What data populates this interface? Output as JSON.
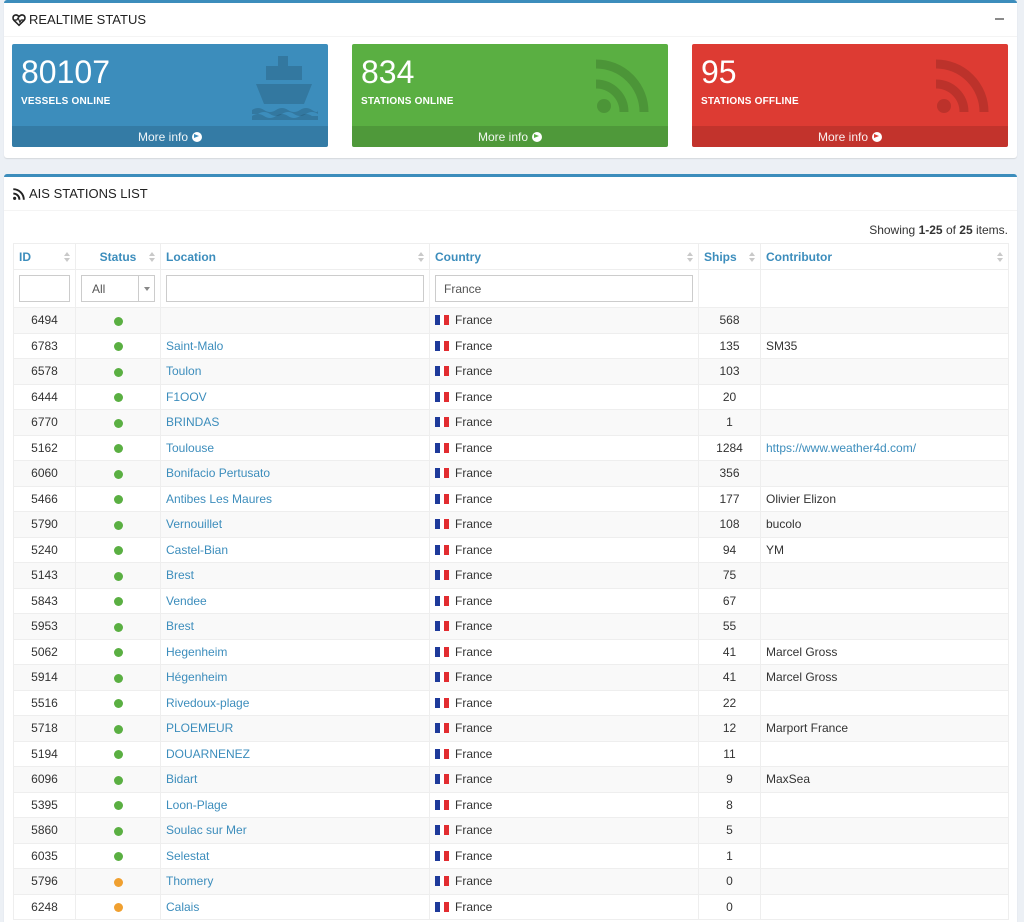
{
  "status_box": {
    "title": "REALTIME STATUS",
    "tiles": [
      {
        "value": "80107",
        "label": "VESSELS ONLINE",
        "more": "More info",
        "color": "#3c8dbc",
        "icon": "ship-icon"
      },
      {
        "value": "834",
        "label": "STATIONS ONLINE",
        "more": "More info",
        "color": "#5aaf42",
        "icon": "rss-icon"
      },
      {
        "value": "95",
        "label": "STATIONS OFFLINE",
        "more": "More info",
        "color": "#dd3b33",
        "icon": "rss-icon"
      }
    ]
  },
  "list_box": {
    "title": "AIS STATIONS LIST",
    "summary": {
      "prefix": "Showing ",
      "range": "1-25",
      "middle": " of ",
      "total": "25",
      "suffix": " items."
    },
    "columns": [
      "ID",
      "Status",
      "Location",
      "Country",
      "Ships",
      "Contributor"
    ],
    "filters": {
      "id": "",
      "status": "All",
      "location": "",
      "country": "France"
    },
    "rows": [
      {
        "id": "6494",
        "status": "online",
        "location": "",
        "country": "France",
        "ships": "568",
        "contributor": ""
      },
      {
        "id": "6783",
        "status": "online",
        "location": "Saint-Malo",
        "country": "France",
        "ships": "135",
        "contributor": "SM35"
      },
      {
        "id": "6578",
        "status": "online",
        "location": "Toulon",
        "country": "France",
        "ships": "103",
        "contributor": ""
      },
      {
        "id": "6444",
        "status": "online",
        "location": "F1OOV",
        "country": "France",
        "ships": "20",
        "contributor": ""
      },
      {
        "id": "6770",
        "status": "online",
        "location": "BRINDAS",
        "country": "France",
        "ships": "1",
        "contributor": ""
      },
      {
        "id": "5162",
        "status": "online",
        "location": "Toulouse",
        "country": "France",
        "ships": "1284",
        "contributor": "https://www.weather4d.com/",
        "contributor_link": true
      },
      {
        "id": "6060",
        "status": "online",
        "location": "Bonifacio Pertusato",
        "country": "France",
        "ships": "356",
        "contributor": ""
      },
      {
        "id": "5466",
        "status": "online",
        "location": "Antibes Les Maures",
        "country": "France",
        "ships": "177",
        "contributor": "Olivier Elizon"
      },
      {
        "id": "5790",
        "status": "online",
        "location": "Vernouillet",
        "country": "France",
        "ships": "108",
        "contributor": "bucolo"
      },
      {
        "id": "5240",
        "status": "online",
        "location": "Castel-Bian",
        "country": "France",
        "ships": "94",
        "contributor": "YM"
      },
      {
        "id": "5143",
        "status": "online",
        "location": "Brest",
        "country": "France",
        "ships": "75",
        "contributor": ""
      },
      {
        "id": "5843",
        "status": "online",
        "location": "Vendee",
        "country": "France",
        "ships": "67",
        "contributor": ""
      },
      {
        "id": "5953",
        "status": "online",
        "location": "Brest",
        "country": "France",
        "ships": "55",
        "contributor": ""
      },
      {
        "id": "5062",
        "status": "online",
        "location": "Hegenheim",
        "country": "France",
        "ships": "41",
        "contributor": "Marcel Gross"
      },
      {
        "id": "5914",
        "status": "online",
        "location": "Hégenheim",
        "country": "France",
        "ships": "41",
        "contributor": "Marcel Gross"
      },
      {
        "id": "5516",
        "status": "online",
        "location": "Rivedoux-plage",
        "country": "France",
        "ships": "22",
        "contributor": ""
      },
      {
        "id": "5718",
        "status": "online",
        "location": "PLOEMEUR",
        "country": "France",
        "ships": "12",
        "contributor": "Marport France"
      },
      {
        "id": "5194",
        "status": "online",
        "location": "DOUARNENEZ",
        "country": "France",
        "ships": "11",
        "contributor": ""
      },
      {
        "id": "6096",
        "status": "online",
        "location": "Bidart",
        "country": "France",
        "ships": "9",
        "contributor": "MaxSea"
      },
      {
        "id": "5395",
        "status": "online",
        "location": "Loon-Plage",
        "country": "France",
        "ships": "8",
        "contributor": ""
      },
      {
        "id": "5860",
        "status": "online",
        "location": "Soulac sur Mer",
        "country": "France",
        "ships": "5",
        "contributor": ""
      },
      {
        "id": "6035",
        "status": "online",
        "location": "Selestat",
        "country": "France",
        "ships": "1",
        "contributor": ""
      },
      {
        "id": "5796",
        "status": "pending",
        "location": "Thomery",
        "country": "France",
        "ships": "0",
        "contributor": ""
      },
      {
        "id": "6248",
        "status": "pending",
        "location": "Calais",
        "country": "France",
        "ships": "0",
        "contributor": ""
      }
    ]
  },
  "colors": {
    "online": "#5aaf42",
    "pending": "#f0a030",
    "link": "#3c8dbc"
  }
}
